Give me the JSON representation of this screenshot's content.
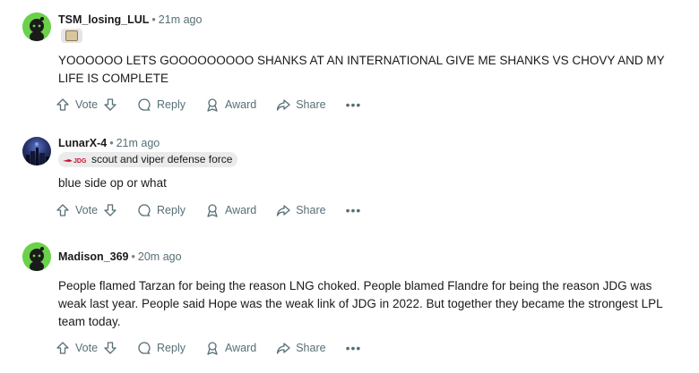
{
  "comments": [
    {
      "username": "TSM_losing_LUL",
      "time": "21m ago",
      "text": "YOOOOOO LETS GOOOOOOOOO SHANKS AT AN INTERNATIONAL GIVE ME SHANKS VS CHOVY AND MY LIFE IS COMPLETE",
      "flair_badge": "team-badge-icon"
    },
    {
      "username": "LunarX-4",
      "time": "21m ago",
      "flair_text": "scout and viper defense force",
      "text": "blue side op or what"
    },
    {
      "username": "Madison_369",
      "time": "20m ago",
      "text": "People flamed Tarzan for being the reason LNG choked. People blamed Flandre for being the reason JDG was weak last year. People said Hope was the weak link of JDG in 2022. But together they became the strongest LPL team today."
    }
  ],
  "actions": {
    "vote": "Vote",
    "reply": "Reply",
    "award": "Award",
    "share": "Share",
    "more": "•••"
  },
  "colors": {
    "avatar_green": "#6bd14a",
    "meta_gray": "#576f76",
    "text": "#1a1a1b"
  }
}
